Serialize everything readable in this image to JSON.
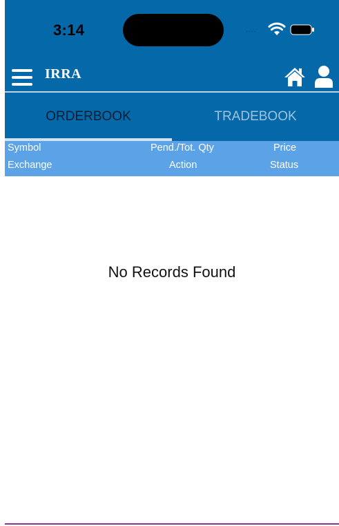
{
  "status_bar": {
    "time": "3:14",
    "signal": "....",
    "wifi_icon": "wifi-icon",
    "battery_icon": "battery-icon"
  },
  "app_bar": {
    "title": "IRRA",
    "menu_icon": "hamburger-menu-icon",
    "home_icon": "home-icon",
    "user_icon": "user-icon",
    "background_color": "#0569a9"
  },
  "tabs": [
    {
      "label": "ORDERBOOK",
      "active": true
    },
    {
      "label": "TRADEBOOK",
      "active": false
    }
  ],
  "columns": {
    "row1": [
      "Symbol",
      "Pend./Tot. Qty",
      "Price"
    ],
    "row2": [
      "Exchange",
      "Action",
      "Status"
    ],
    "background_color": "#5ba3e6"
  },
  "empty_message": "No Records Found"
}
